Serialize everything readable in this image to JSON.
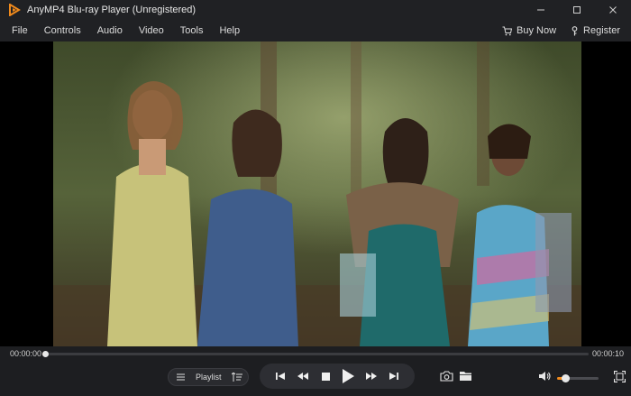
{
  "window": {
    "title": "AnyMP4 Blu-ray Player (Unregistered)",
    "controls": [
      "minimize",
      "maximize",
      "close"
    ]
  },
  "menu": {
    "items": [
      "File",
      "Controls",
      "Audio",
      "Video",
      "Tools",
      "Help"
    ],
    "buy_now": "Buy Now",
    "register": "Register"
  },
  "player": {
    "current_time": "00:00:00",
    "total_time": "00:00:10",
    "progress": 0.005,
    "volume": 0.2
  },
  "playlist": {
    "label": "Playlist"
  },
  "icons": {
    "logo": "anymp4-logo-icon",
    "accent": "#f08a1c"
  }
}
